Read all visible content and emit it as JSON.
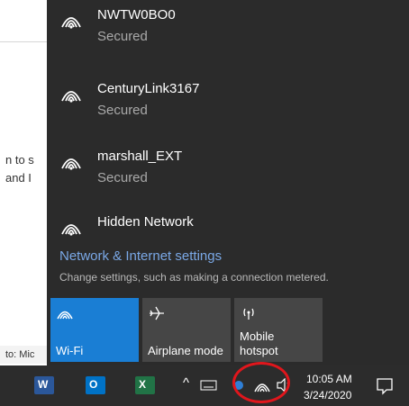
{
  "background_document": {
    "line1": "n to s",
    "line2": "and I",
    "status": "to: Mic"
  },
  "networks": [
    {
      "name": "NWTW0BO0",
      "state": "Secured"
    },
    {
      "name": "CenturyLink3167",
      "state": "Secured"
    },
    {
      "name": "marshall_EXT",
      "state": "Secured"
    },
    {
      "name": "Hidden Network",
      "state": ""
    }
  ],
  "settings": {
    "link": "Network & Internet settings",
    "description": "Change settings, such as making a connection metered."
  },
  "quick_actions": [
    {
      "label": "Wi-Fi",
      "icon": "wifi-icon",
      "active": true
    },
    {
      "label": "Airplane mode",
      "icon": "airplane-icon",
      "active": false
    },
    {
      "label": "Mobile hotspot",
      "icon": "hotspot-icon",
      "active": false
    }
  ],
  "taskbar": {
    "apps": [
      {
        "icon": "word-icon",
        "letter": "W",
        "color": "#2b579a"
      },
      {
        "icon": "outlook-icon",
        "letter": "O",
        "color": "#0072c6"
      },
      {
        "icon": "excel-icon",
        "letter": "X",
        "color": "#217346"
      }
    ],
    "tray": {
      "chevron": "^",
      "time": "10:05 AM",
      "date": "3/24/2020"
    }
  },
  "colors": {
    "flyout_bg": "#2b2b2b",
    "accent": "#1a7ed4",
    "link": "#7aa8e6",
    "highlight_circle": "#e0161c"
  }
}
